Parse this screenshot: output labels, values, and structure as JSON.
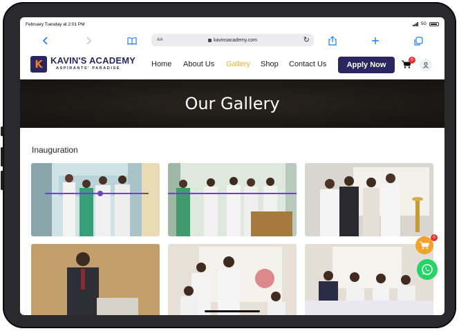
{
  "status_bar": {
    "datetime": "February Tuesday at 2:01 PM",
    "signal": "5G"
  },
  "browser": {
    "aa_label": "AA",
    "url": "kavinsacademy.com"
  },
  "site": {
    "logo_letter": "K",
    "logo_title": "KAVIN'S ACADEMY",
    "logo_subtitle": "ASPIRANTS' PARADISE",
    "nav": [
      "Home",
      "About Us",
      "Gallery",
      "Shop",
      "Contact Us"
    ],
    "active_nav": "Gallery",
    "apply_label": "Apply Now",
    "cart_count": "0"
  },
  "hero": {
    "title": "Our Gallery"
  },
  "gallery": {
    "section_title": "Inauguration",
    "photos": [
      "ribbon-cutting-photo-1",
      "ribbon-cutting-photo-2",
      "lamp-lighting-photo",
      "speaker-podium-photo",
      "microphone-speech-photo",
      "stage-guests-photo"
    ]
  },
  "floating": {
    "cart_count": "0"
  },
  "colors": {
    "brand": "#2b2660",
    "accent": "#f0b323",
    "whatsapp": "#25d366",
    "badge": "#e53131"
  }
}
